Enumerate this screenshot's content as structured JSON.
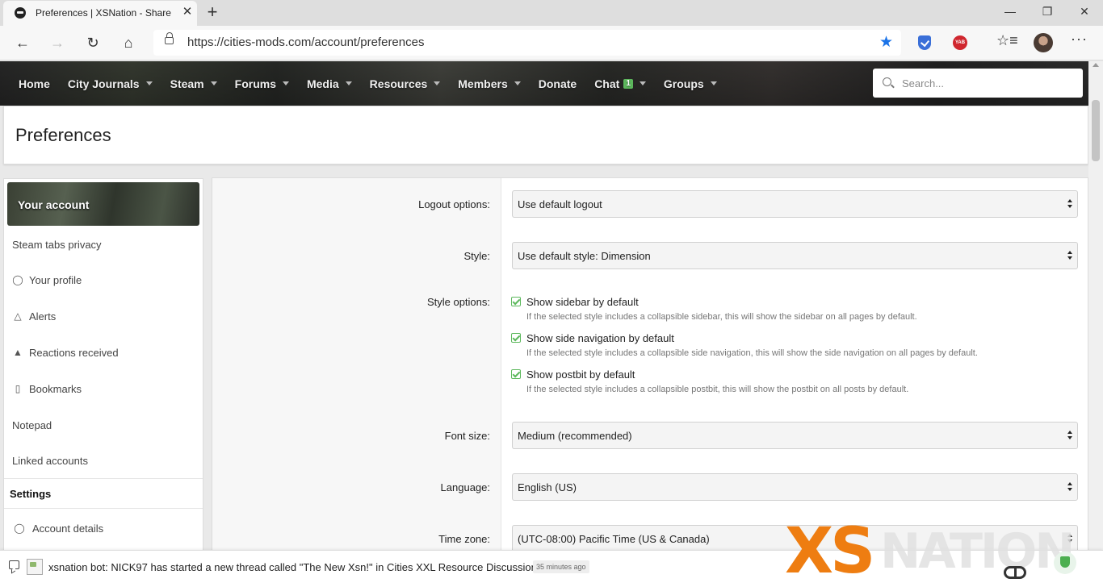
{
  "browser": {
    "tab_title": "Preferences | XSNation - Share | ",
    "tab_close": "✕",
    "new_tab": "+",
    "url": "https://cities-mods.com/account/preferences",
    "window": {
      "minimize": "—",
      "restore": "❐",
      "close": "✕"
    },
    "nav": {
      "back": "←",
      "forward": "→",
      "reload": "↻",
      "home": "⌂"
    },
    "star": "★",
    "extension_label": "YAB",
    "favorites_icon": "☆≡",
    "menu": "···"
  },
  "site_nav": {
    "items": [
      {
        "label": "Home",
        "dropdown": false
      },
      {
        "label": "City Journals",
        "dropdown": true
      },
      {
        "label": "Steam",
        "dropdown": true
      },
      {
        "label": "Forums",
        "dropdown": true
      },
      {
        "label": "Media",
        "dropdown": true
      },
      {
        "label": "Resources",
        "dropdown": true
      },
      {
        "label": "Members",
        "dropdown": true
      },
      {
        "label": "Donate",
        "dropdown": false
      },
      {
        "label": "Chat",
        "dropdown": true,
        "badge": "1"
      },
      {
        "label": "Groups",
        "dropdown": true
      }
    ],
    "search_placeholder": "Search..."
  },
  "page": {
    "title": "Preferences"
  },
  "sidebar": {
    "header": "Your account",
    "items": [
      {
        "label": "Steam tabs privacy",
        "icon": ""
      },
      {
        "label": "Your profile",
        "icon": "user-icon"
      },
      {
        "label": "Alerts",
        "icon": "bell-icon"
      },
      {
        "label": "Reactions received",
        "icon": "thumbs-up-icon"
      },
      {
        "label": "Bookmarks",
        "icon": "bookmark-icon"
      },
      {
        "label": "Notepad",
        "icon": ""
      },
      {
        "label": "Linked accounts",
        "icon": ""
      }
    ],
    "settings_header": "Settings",
    "settings_items": [
      {
        "label": "Account details",
        "icon": "user-cog-icon"
      }
    ]
  },
  "form": {
    "logout": {
      "label": "Logout options:",
      "value": "Use default logout"
    },
    "style": {
      "label": "Style:",
      "value": "Use default style: Dimension"
    },
    "style_options": {
      "label": "Style options:",
      "checks": [
        {
          "label": "Show sidebar by default",
          "hint": "If the selected style includes a collapsible sidebar, this will show the sidebar on all pages by default.",
          "checked": true
        },
        {
          "label": "Show side navigation by default",
          "hint": "If the selected style includes a collapsible side navigation, this will show the side navigation on all pages by default.",
          "checked": true
        },
        {
          "label": "Show postbit by default",
          "hint": "If the selected style includes a collapsible postbit, this will show the postbit on all posts by default.",
          "checked": true
        }
      ]
    },
    "font_size": {
      "label": "Font size:",
      "value": "Medium (recommended)"
    },
    "language": {
      "label": "Language:",
      "value": "English (US)"
    },
    "time_zone": {
      "label": "Time zone:",
      "value": "(UTC-08:00) Pacific Time (US & Canada)"
    }
  },
  "notification": {
    "text": "xsnation bot: NICK97 has started a new thread called \"The New Xsn!\" in Cities XXL Resource Discussions.",
    "time": "35 minutes ago"
  },
  "watermark": {
    "primary": "XS",
    "secondary": "NATION"
  },
  "colors": {
    "accent_green": "#5cb85c",
    "watermark_orange": "#ee7d11",
    "star_blue": "#1a73e8"
  }
}
